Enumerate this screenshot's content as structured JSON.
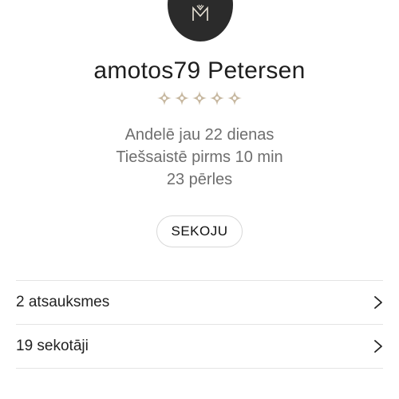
{
  "profile": {
    "username": "amotos79 Petersen",
    "rating_stars": 5,
    "star_color": "#c7b8a0",
    "avatar_color": "#2b2b2b",
    "avatar_icon": "monogram-logo-icon",
    "stats": {
      "member_since": "Andelē jau 22 dienas",
      "last_online": "Tiešsaistē pirms 10 min",
      "pearls": "23 pērles"
    },
    "follow_button_label": "SEKOJU"
  },
  "list": {
    "items": [
      {
        "label": "2 atsauksmes",
        "icon": "chevron-right-icon"
      },
      {
        "label": "19 sekotāji",
        "icon": "chevron-right-icon"
      }
    ]
  }
}
